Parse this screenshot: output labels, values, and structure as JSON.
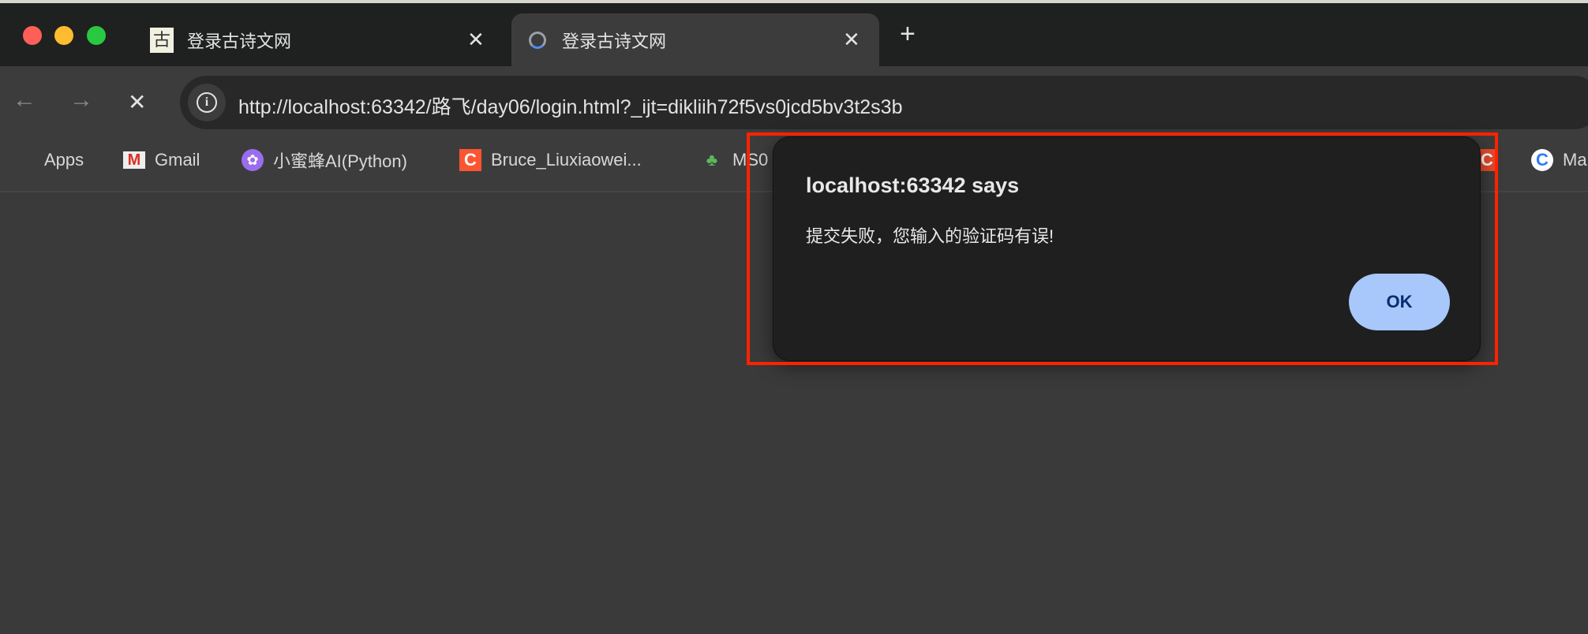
{
  "window": {
    "controls": [
      "close",
      "minimize",
      "maximize"
    ]
  },
  "tabs": [
    {
      "title": "登录古诗文网",
      "favicon": "gushiwen-icon",
      "active": false
    },
    {
      "title": "登录古诗文网",
      "favicon": "loading-globe-icon",
      "active": true
    }
  ],
  "new_tab_label": "+",
  "close_tab_label": "✕",
  "toolbar": {
    "back": "←",
    "forward": "→",
    "stop": "✕",
    "url": "http://localhost:63342/路飞/day06/login.html?_ijt=dikliih72f5vs0jcd5bv3t2s3b",
    "site_info_icon": "info-icon"
  },
  "bookmarks": [
    {
      "label": "Apps",
      "icon": "apps-grid-icon"
    },
    {
      "label": "Gmail",
      "icon": "gmail-icon"
    },
    {
      "label": "小蜜蜂AI(Python)",
      "icon": "openai-icon"
    },
    {
      "label": "Bruce_Liuxiaowei...",
      "icon": "csdn-icon"
    },
    {
      "label": "MS0",
      "icon": "cactus-icon"
    },
    {
      "label": "",
      "icon": "csdn-icon"
    },
    {
      "label": "Ma",
      "icon": "c-logo-icon"
    }
  ],
  "dialog": {
    "title": "localhost:63342 says",
    "message": "提交失败，您输入的验证码有误!",
    "ok_label": "OK",
    "highlight_color": "#ff2200",
    "ok_color": "#a8c7fa"
  }
}
